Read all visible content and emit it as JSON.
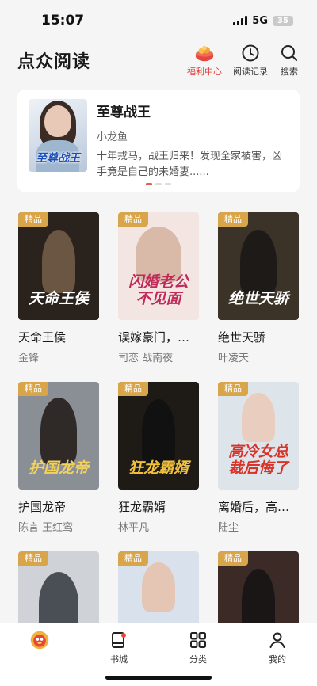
{
  "status": {
    "time": "15:07",
    "network": "5G",
    "battery": "35"
  },
  "header": {
    "title": "点众阅读",
    "actions": [
      {
        "label": "福利中心",
        "icon": "gift-basket-icon",
        "color": "#e0403a"
      },
      {
        "label": "阅读记录",
        "icon": "clock-icon"
      },
      {
        "label": "搜索",
        "icon": "search-icon"
      }
    ]
  },
  "featured": {
    "cover_text": "至尊战王",
    "title": "至尊战王",
    "author": "小龙鱼",
    "description": "十年戎马，战王归来！发现全家被害，凶手竟是自己的未婚妻......",
    "carousel_index": 0,
    "carousel_count": 3
  },
  "badge_label": "精品",
  "books": [
    {
      "cover_text": "天命王侯",
      "title": "天命王侯",
      "author": "金锋",
      "cover_color": "#2a221c",
      "text_color": "#ffffff"
    },
    {
      "cover_text": "闪婚老公不见面",
      "title": "误嫁豪门，…",
      "author": "司恋  战南夜",
      "cover_color": "#f3e6e2",
      "text_color": "#c02a5a"
    },
    {
      "cover_text": "绝世天骄",
      "title": "绝世天骄",
      "author": "叶凌天",
      "cover_color": "#3b3327",
      "text_color": "#ffffff"
    },
    {
      "cover_text": "护国龙帝",
      "title": "护国龙帝",
      "author": "陈言  王红鸾",
      "cover_color": "#8a8f96",
      "text_color": "#f2d25a"
    },
    {
      "cover_text": "狂龙霸婿",
      "title": "狂龙霸婿",
      "author": "林平凡",
      "cover_color": "#1e1a16",
      "text_color": "#f2c13a"
    },
    {
      "cover_text": "高冷女总裁后悔了",
      "title": "离婚后，高…",
      "author": "陆尘",
      "cover_color": "#dde4ea",
      "text_color": "#d8342a"
    },
    {
      "cover_text": "",
      "title": "",
      "author": "",
      "cover_color": "#cfd3d8",
      "text_color": "#ffffff"
    },
    {
      "cover_text": "",
      "title": "",
      "author": "",
      "cover_color": "#d9e2ec",
      "text_color": "#2c6fd1"
    },
    {
      "cover_text": "",
      "title": "",
      "author": "",
      "cover_color": "#3b2a26",
      "text_color": "#ffffff"
    }
  ],
  "tabbar": [
    {
      "label": "",
      "icon": "mascot-icon"
    },
    {
      "label": "书城",
      "icon": "bookstore-icon"
    },
    {
      "label": "分类",
      "icon": "category-grid-icon"
    },
    {
      "label": "我的",
      "icon": "profile-icon"
    }
  ]
}
